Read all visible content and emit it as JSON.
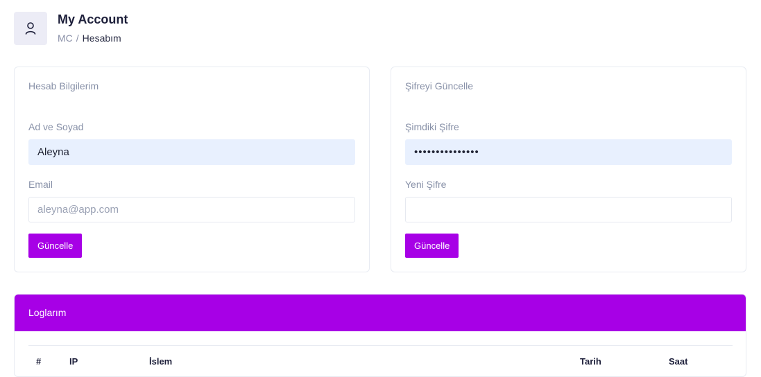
{
  "header": {
    "title": "My Account",
    "breadcrumb_root": "MC",
    "breadcrumb_sep": "/",
    "breadcrumb_current": "Hesabım",
    "icon": "user-icon"
  },
  "account_card": {
    "title": "Hesab Bilgilerim",
    "name_label": "Ad ve Soyad",
    "name_value": "Aleyna",
    "email_label": "Email",
    "email_placeholder": "aleyna@app.com",
    "submit_label": "Güncelle"
  },
  "password_card": {
    "title": "Şifreyi Güncelle",
    "current_label": "Şimdiki Şifre",
    "current_value": "•••••••••••••••",
    "new_label": "Yeni Şifre",
    "new_value": "",
    "submit_label": "Güncelle"
  },
  "logs": {
    "title": "Loglarım",
    "columns": [
      "#",
      "IP",
      "İslem",
      "Tarih",
      "Saat"
    ]
  },
  "colors": {
    "accent": "#a700e6",
    "input_filled": "#e8f0fe",
    "avatar_bg": "#ececf6"
  }
}
